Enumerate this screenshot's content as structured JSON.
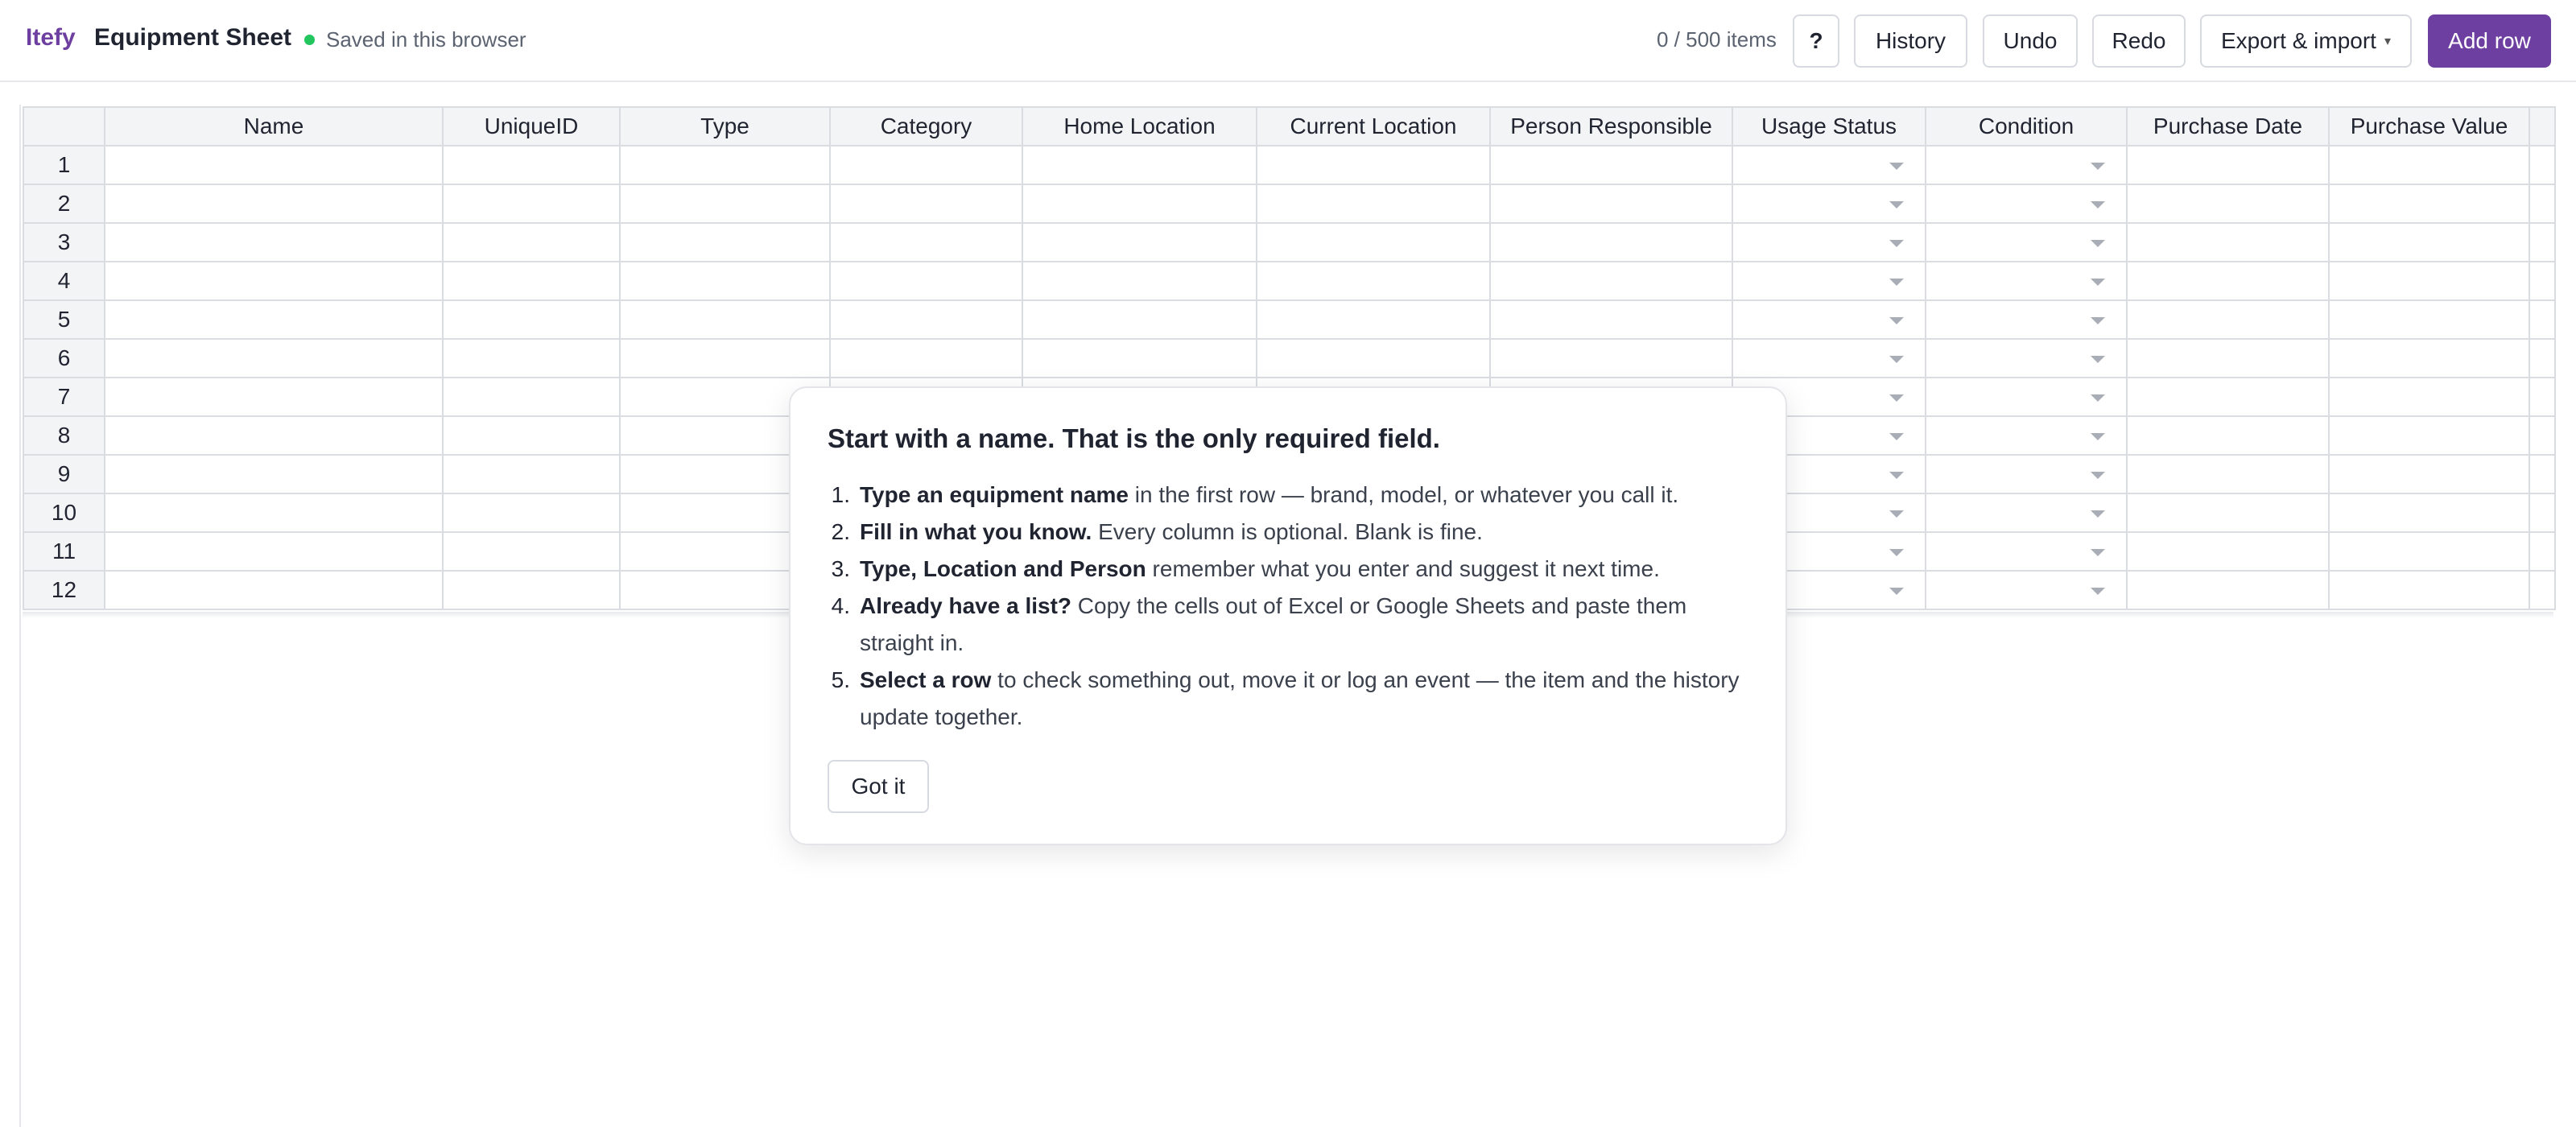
{
  "header": {
    "brand": "Itefy",
    "title": "Equipment Sheet",
    "saved_status": "Saved in this browser",
    "item_count": "0 / 500 items",
    "help_label": "?",
    "history_label": "History",
    "undo_label": "Undo",
    "redo_label": "Redo",
    "export_label": "Export & import",
    "export_caret": "▾",
    "add_row_label": "Add row",
    "accent_color": "#6d3fa0",
    "saved_color": "#22c55e"
  },
  "sheet": {
    "columns": [
      {
        "label": "Name",
        "dropdown": false
      },
      {
        "label": "UniqueID",
        "dropdown": false
      },
      {
        "label": "Type",
        "dropdown": false
      },
      {
        "label": "Category",
        "dropdown": false
      },
      {
        "label": "Home Location",
        "dropdown": false
      },
      {
        "label": "Current Location",
        "dropdown": false
      },
      {
        "label": "Person Responsible",
        "dropdown": false
      },
      {
        "label": "Usage Status",
        "dropdown": true
      },
      {
        "label": "Condition",
        "dropdown": true
      },
      {
        "label": "Purchase Date",
        "dropdown": false
      },
      {
        "label": "Purchase Value",
        "dropdown": false
      }
    ],
    "rows": [
      "1",
      "2",
      "3",
      "4",
      "5",
      "6",
      "7",
      "8",
      "9",
      "10",
      "11",
      "12"
    ]
  },
  "onboarding": {
    "title": "Start with a name. That is the only required field.",
    "steps": [
      {
        "num": "1.",
        "bold": "Type an equipment name",
        "text": " in the first row — brand, model, or whatever you call it."
      },
      {
        "num": "2.",
        "bold": "Fill in what you know.",
        "text": " Every column is optional. Blank is fine."
      },
      {
        "num": "3.",
        "bold": "Type, Location and Person",
        "text": " remember what you enter and suggest it next time."
      },
      {
        "num": "4.",
        "bold": "Already have a list?",
        "text": " Copy the cells out of Excel or Google Sheets and paste them straight in."
      },
      {
        "num": "5.",
        "bold": "Select a row",
        "text": " to check something out, move it or log an event — the item and the history update together."
      }
    ],
    "button_label": "Got it"
  }
}
